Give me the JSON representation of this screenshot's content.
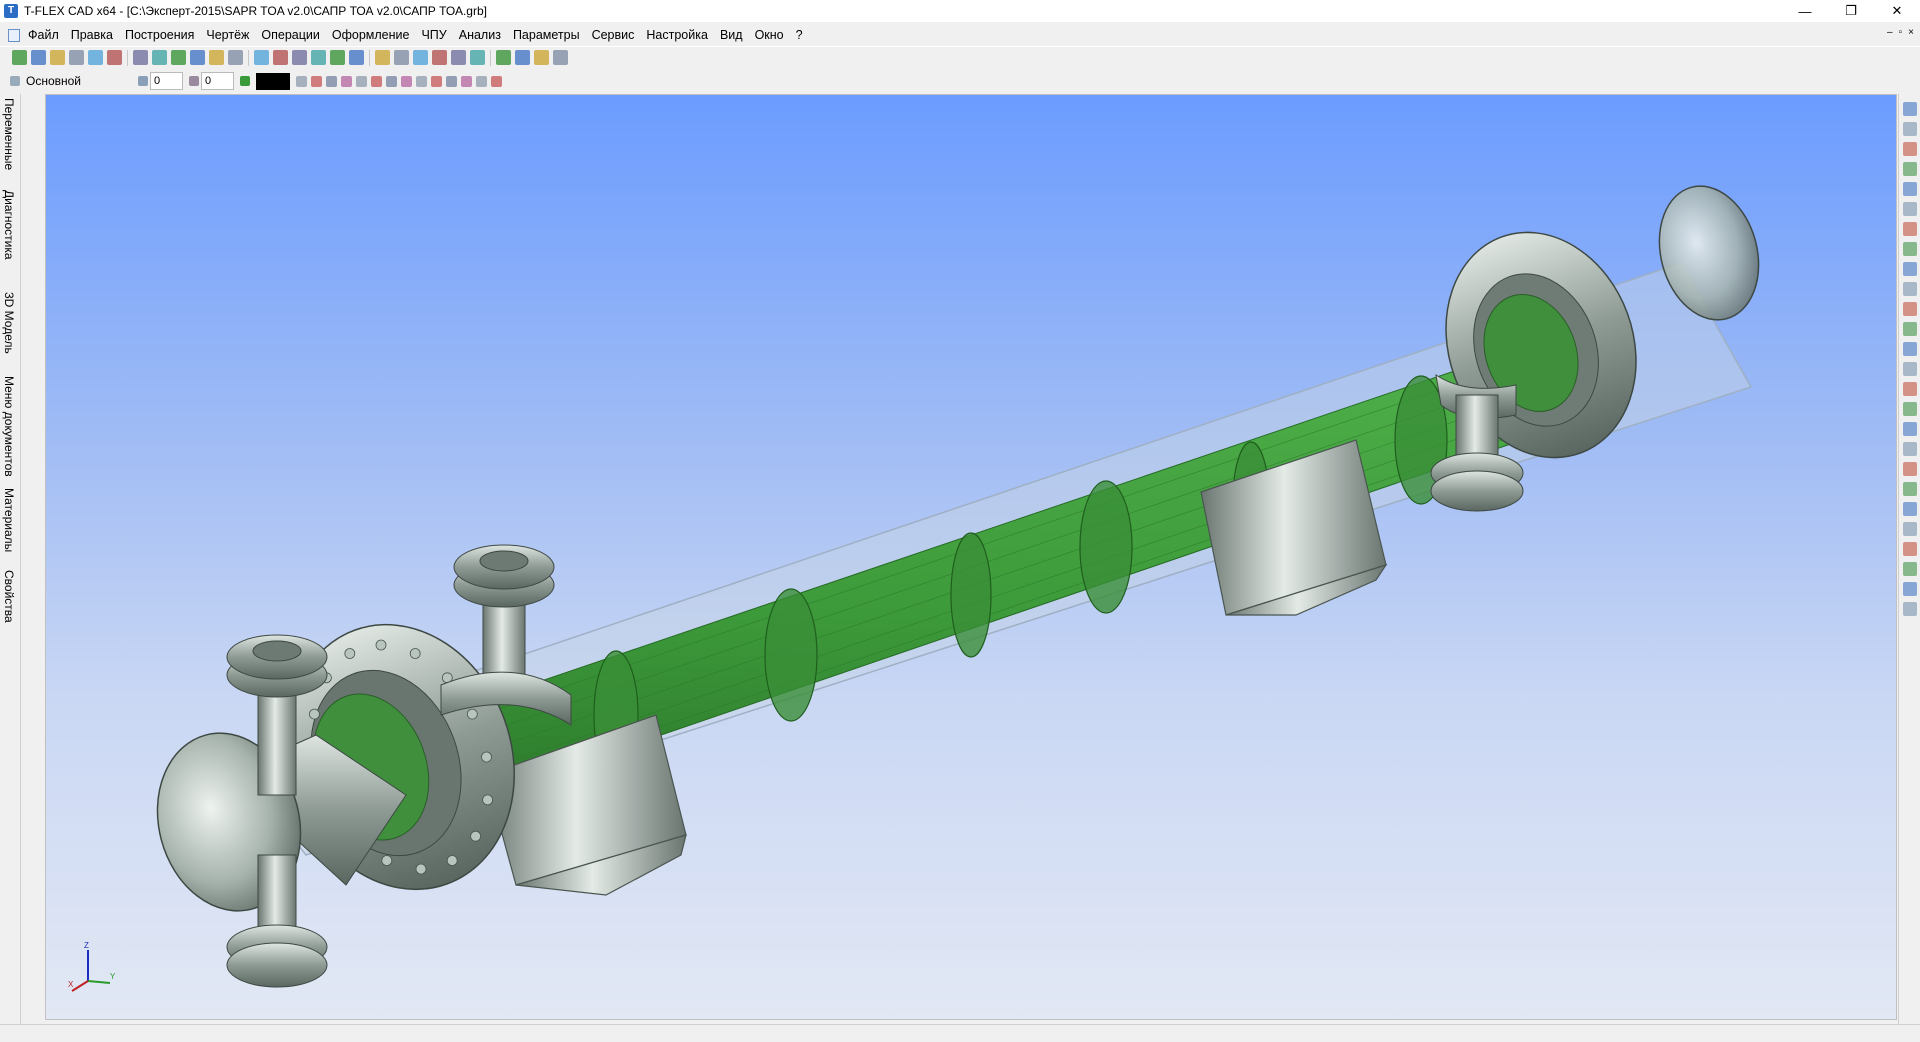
{
  "window": {
    "title": "T-FLEX CAD x64 - [C:\\Эксперт-2015\\SAPR TOA v2.0\\САПР ТОА v2.0\\САПР ТОА.grb]",
    "minimize": "—",
    "restore": "❐",
    "close": "✕"
  },
  "menu": {
    "items": [
      "Файл",
      "Правка",
      "Построения",
      "Чертёж",
      "Операции",
      "Оформление",
      "ЧПУ",
      "Анализ",
      "Параметры",
      "Сервис",
      "Настройка",
      "Вид",
      "Окно",
      "?"
    ]
  },
  "toolbar2": {
    "layer": "Основной",
    "level_value": "0",
    "priority_value": "0",
    "color": "#000000"
  },
  "left_tabs": [
    "Переменные",
    "Диагностика",
    "3D Модель",
    "Меню документов",
    "Материалы",
    "Свойства"
  ],
  "axes": {
    "x": "X",
    "y": "Y",
    "z": "Z"
  },
  "colors": {
    "tube_bundle": "#3d9a3a",
    "metal": "#8e9a94",
    "background_top": "#6b9cff",
    "background_bottom": "#e2e8f4"
  },
  "icons": {
    "toolbar1": [
      "confirm-icon",
      "new-doc-icon",
      "open-icon",
      "save-icon",
      "print-preview-icon",
      "print-icon",
      "undo-icon",
      "redo-icon",
      "edit-icon",
      "select-icon",
      "point-icon",
      "workplane-icon",
      "lcs-icon",
      "extrude-icon",
      "revolve-icon",
      "loft-icon",
      "sweep-icon",
      "boolean-icon",
      "fillet-icon",
      "chamfer-icon",
      "shell-icon",
      "array-icon",
      "mirror-icon",
      "section-icon",
      "measure-icon",
      "render-icon",
      "link-icon",
      "settings-icon"
    ],
    "right": [
      "view-icon",
      "pan-icon",
      "rotate-icon",
      "zoom-icon",
      "zoom-window-icon",
      "fit-icon",
      "zoom-in-icon",
      "zoom-out-icon",
      "zoom-prev-icon",
      "light-icon",
      "camera-icon",
      "walk-icon",
      "orient-icon",
      "snap-icon",
      "grid-icon",
      "layer-icon",
      "material-icon",
      "check-icon",
      "shade-icon",
      "wire-icon",
      "hidden-icon",
      "box-icon",
      "front-view-icon",
      "iso-view-icon",
      "top-view-icon",
      "section-view-icon"
    ]
  }
}
